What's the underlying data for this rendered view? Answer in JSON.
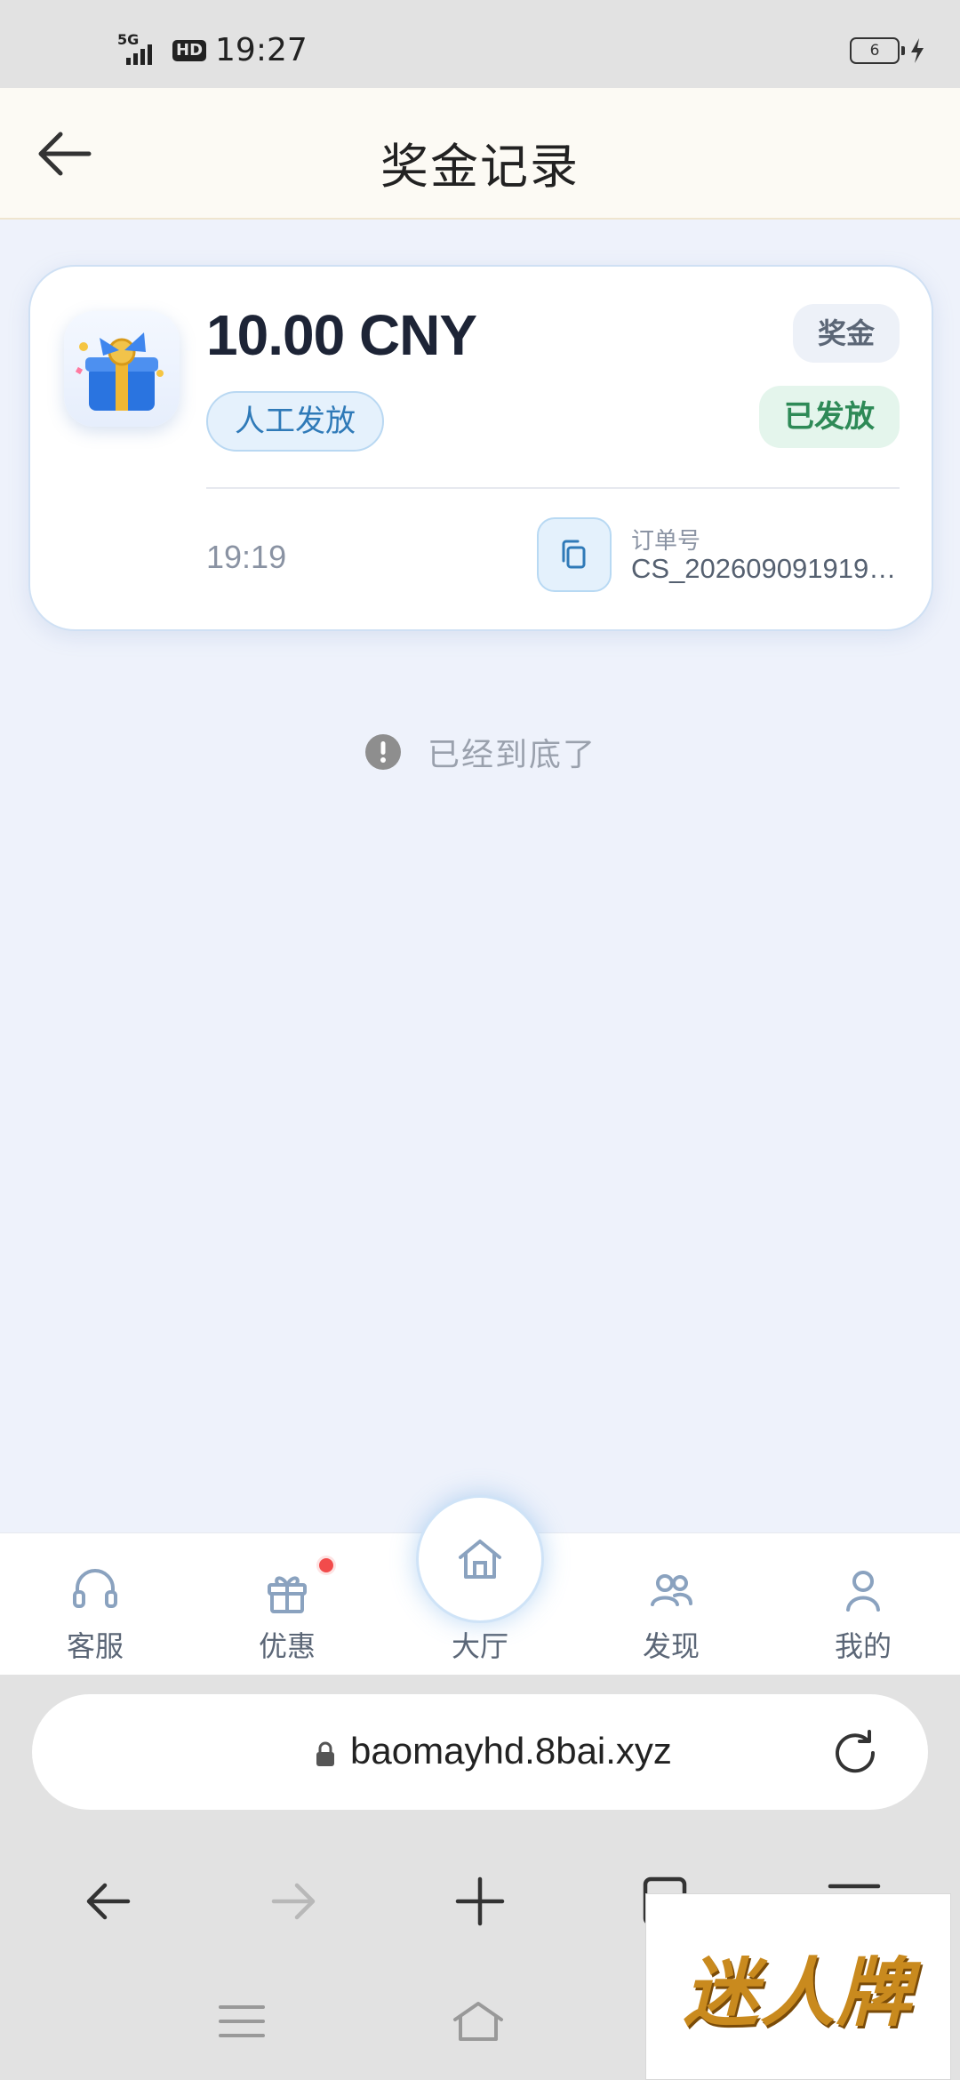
{
  "status_bar": {
    "network": "5G",
    "hd": "HD",
    "time": "19:27",
    "battery": "6"
  },
  "header": {
    "title": "奖金记录"
  },
  "record": {
    "amount": "10.00 CNY",
    "method_tag": "人工发放",
    "type_tag": "奖金",
    "status_tag": "已发放",
    "time": "19:19",
    "order_label": "订单号",
    "order_no": "CS_202609091919…"
  },
  "end_text": "已经到底了",
  "bottom_nav": {
    "items": [
      {
        "label": "客服",
        "icon": "headset-icon"
      },
      {
        "label": "优惠",
        "icon": "gift-icon"
      },
      {
        "label": "大厅",
        "icon": "home-icon"
      },
      {
        "label": "发现",
        "icon": "people-icon"
      },
      {
        "label": "我的",
        "icon": "user-icon"
      }
    ]
  },
  "browser": {
    "url": "baomayhd.8bai.xyz"
  },
  "watermark": {
    "text": "迷人牌"
  },
  "colors": {
    "accent_blue": "#2f7ab8",
    "status_green": "#2e8a57",
    "badge_red": "#f24b4b",
    "header_bg": "#fcfaf4",
    "page_bg": "#eef2fb"
  }
}
